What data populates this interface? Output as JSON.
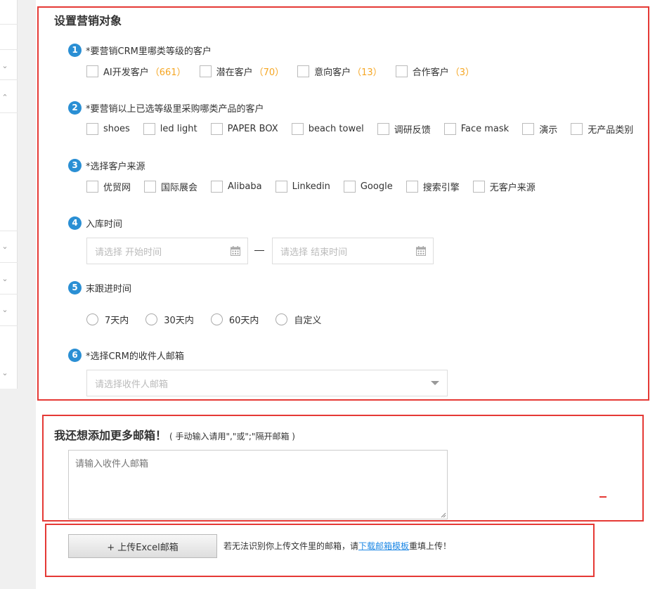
{
  "section": {
    "title": "设置营销对象"
  },
  "steps": [
    {
      "num": "1",
      "label": "*要营销CRM里哪类等级的客户"
    },
    {
      "num": "2",
      "label": "*要营销以上已选等级里采购哪类产品的客户"
    },
    {
      "num": "3",
      "label": "*选择客户来源"
    },
    {
      "num": "4",
      "label": "入库时间"
    },
    {
      "num": "5",
      "label": "末跟进时间"
    },
    {
      "num": "6",
      "label": "*选择CRM的收件人邮箱"
    }
  ],
  "customer_levels": [
    {
      "label": "AI开发客户",
      "count": "（661）"
    },
    {
      "label": "潜在客户",
      "count": "（70）"
    },
    {
      "label": "意向客户",
      "count": "（13）"
    },
    {
      "label": "合作客户",
      "count": "（3）"
    }
  ],
  "product_categories": [
    "shoes",
    "led light",
    "PAPER BOX",
    "beach towel",
    "调研反馈",
    "Face mask",
    "演示",
    "无产品类别"
  ],
  "customer_sources": [
    "优贸网",
    "国际展会",
    "Alibaba",
    "Linkedin",
    "Google",
    "搜索引擎",
    "无客户来源"
  ],
  "date_range": {
    "start_placeholder": "请选择 开始时间",
    "end_placeholder": "请选择 结束时间"
  },
  "followup_options": [
    "7天内",
    "30天内",
    "60天内",
    "自定义"
  ],
  "email_select": {
    "placeholder": "请选择收件人邮箱"
  },
  "more_emails": {
    "title": "我还想添加更多邮箱！",
    "hint": "( 手动输入请用\",\"或\";\"隔开邮箱 )",
    "textarea_placeholder": "请输入收件人邮箱"
  },
  "upload": {
    "button_label": "+ 上传Excel邮箱",
    "hint_before": "若无法识别你上传文件里的邮箱，请",
    "link_text": "下载邮箱模板",
    "hint_after": "重填上传！"
  },
  "colors": {
    "accent_blue": "#2a8fd4",
    "count_orange": "#f5a623",
    "highlight_red": "#e53935",
    "link_blue": "#1e88e5"
  },
  "icons": {
    "date": "calendar-icon",
    "select": "caret-down-icon",
    "sidebar": "chevron-down-icon"
  }
}
